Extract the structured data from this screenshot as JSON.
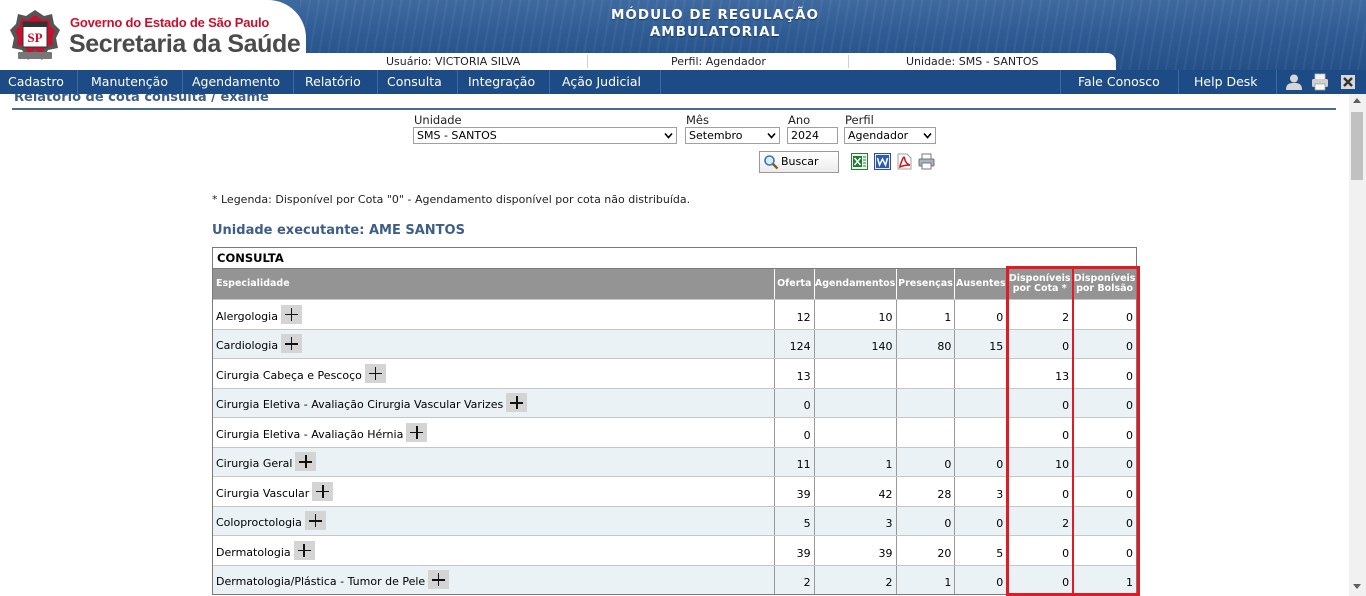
{
  "header": {
    "gov_name": "Governo do Estado de São Paulo",
    "org_name": "Secretaria da Saúde",
    "seal_text": "SP",
    "module_line1": "MÓDULO DE REGULAÇÃO",
    "module_line2": "AMBULATORIAL",
    "user": "Usuário: VICTORIA SILVA",
    "profile": "Perfil: Agendador",
    "unit": "Unidade: SMS - SANTOS"
  },
  "menu": {
    "items": [
      "Cadastro",
      "Manutenção",
      "Agendamento",
      "Relatório",
      "Consulta",
      "Integração",
      "Ação Judicial"
    ],
    "right_items": [
      "Fale Conosco",
      "Help Desk"
    ]
  },
  "page": {
    "title": "Relatório de cota consulta / exame"
  },
  "filters": {
    "unidade_label": "Unidade",
    "unidade_value": "SMS - SANTOS",
    "mes_label": "Mês",
    "mes_value": "Setembro",
    "ano_label": "Ano",
    "ano_value": "2024",
    "perfil_label": "Perfil",
    "perfil_value": "Agendador",
    "search_button": "Buscar"
  },
  "legend": "* Legenda: Disponível por Cota \"0\" - Agendamento disponível por cota não distribuída.",
  "unit_title": "Unidade executante: AME SANTOS",
  "table": {
    "caption": "CONSULTA",
    "headers": {
      "especialidade": "Especialidade",
      "oferta": "Oferta",
      "agendamentos": "Agendamentos",
      "presencas": "Presenças",
      "ausentes": "Ausentes",
      "disp_cota_1": "Disponíveis",
      "disp_cota_2": "por Cota *",
      "disp_bolsao_1": "Disponíveis",
      "disp_bolsao_2": "por Bolsão"
    },
    "rows": [
      {
        "esp": "Alergologia",
        "oferta": "12",
        "ag": "10",
        "pr": "1",
        "au": "0",
        "dc": "2",
        "db": "0"
      },
      {
        "esp": "Cardiologia",
        "oferta": "124",
        "ag": "140",
        "pr": "80",
        "au": "15",
        "dc": "0",
        "db": "0"
      },
      {
        "esp": "Cirurgia Cabeça e Pescoço",
        "oferta": "13",
        "ag": "",
        "pr": "",
        "au": "",
        "dc": "13",
        "db": "0"
      },
      {
        "esp": "Cirurgia Eletiva - Avaliação Cirurgia Vascular Varizes",
        "oferta": "0",
        "ag": "",
        "pr": "",
        "au": "",
        "dc": "0",
        "db": "0"
      },
      {
        "esp": "Cirurgia Eletiva - Avaliação Hérnia",
        "oferta": "0",
        "ag": "",
        "pr": "",
        "au": "",
        "dc": "0",
        "db": "0"
      },
      {
        "esp": "Cirurgia Geral",
        "oferta": "11",
        "ag": "1",
        "pr": "0",
        "au": "0",
        "dc": "10",
        "db": "0"
      },
      {
        "esp": "Cirurgia Vascular",
        "oferta": "39",
        "ag": "42",
        "pr": "28",
        "au": "3",
        "dc": "0",
        "db": "0"
      },
      {
        "esp": "Coloproctologia",
        "oferta": "5",
        "ag": "3",
        "pr": "0",
        "au": "0",
        "dc": "2",
        "db": "0"
      },
      {
        "esp": "Dermatologia",
        "oferta": "39",
        "ag": "39",
        "pr": "20",
        "au": "5",
        "dc": "0",
        "db": "0"
      },
      {
        "esp": "Dermatologia/Plástica - Tumor de Pele",
        "oferta": "2",
        "ag": "2",
        "pr": "1",
        "au": "0",
        "dc": "0",
        "db": "1"
      }
    ]
  },
  "colors": {
    "header_blue": "#2f5c94",
    "menu_blue": "#1d4b86",
    "brand_red": "#c8102e",
    "highlight_red": "#e01b24",
    "table_header_gray": "#949494",
    "alt_row": "#ebf2f5"
  },
  "icons": [
    "sp-seal-logo",
    "user-icon",
    "printer-icon",
    "close-icon",
    "search-icon",
    "excel-icon",
    "word-icon",
    "pdf-icon",
    "print-icon",
    "plus-icon",
    "chevron-down-icon"
  ]
}
